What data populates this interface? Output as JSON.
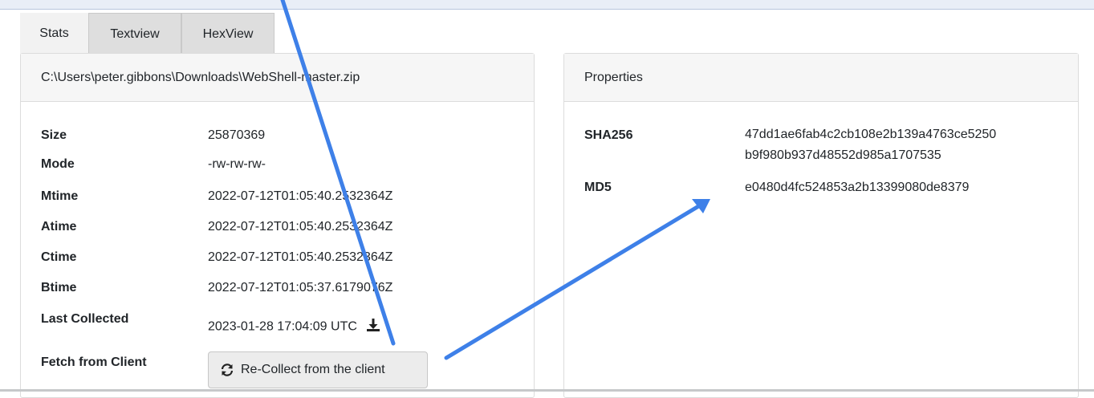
{
  "tabs": [
    "Stats",
    "Textview",
    "HexView"
  ],
  "file_panel": {
    "header": "C:\\Users\\peter.gibbons\\Downloads\\WebShell-master.zip",
    "rows": [
      {
        "label": "Size",
        "value": "25870369"
      },
      {
        "label": "Mode",
        "value": "-rw-rw-rw-"
      },
      {
        "label": "Mtime",
        "value": "2022-07-12T01:05:40.2532364Z"
      },
      {
        "label": "Atime",
        "value": "2022-07-12T01:05:40.2532364Z"
      },
      {
        "label": "Ctime",
        "value": "2022-07-12T01:05:40.2532364Z"
      },
      {
        "label": "Btime",
        "value": "2022-07-12T01:05:37.6179076Z"
      },
      {
        "label": "Last Collected",
        "value": "2023-01-28 17:04:09 UTC"
      }
    ],
    "fetch_label": "Fetch from Client",
    "recollect_button": "Re-Collect from the client",
    "download_icon": "download-icon",
    "refresh_icon": "refresh-icon"
  },
  "properties_panel": {
    "header": "Properties",
    "sha256_label": "SHA256",
    "sha256_line1": "47dd1ae6fab4c2cb108e2b139a4763ce5250",
    "sha256_line2": "b9f980b937d48552d985a1707535",
    "md5_label": "MD5",
    "md5_value": "e0480d4fc524853a2b13399080de8379"
  },
  "annotation_color": "#3e80e8"
}
